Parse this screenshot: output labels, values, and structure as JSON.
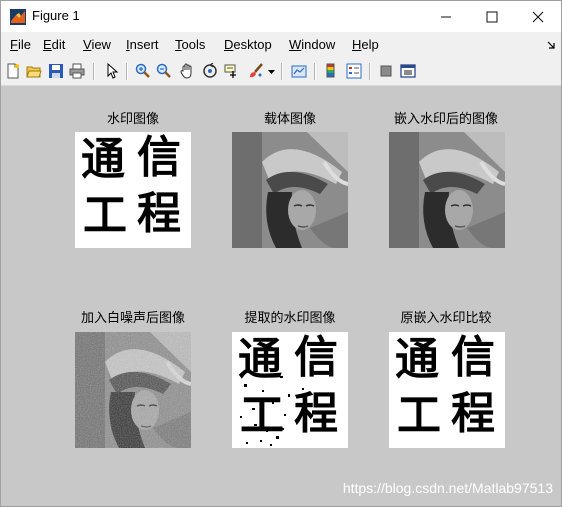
{
  "window": {
    "title": "Figure 1"
  },
  "menu": [
    {
      "u": "F",
      "rest": "ile"
    },
    {
      "u": "E",
      "rest": "dit"
    },
    {
      "u": "V",
      "rest": "iew"
    },
    {
      "u": "I",
      "rest": "nsert"
    },
    {
      "u": "T",
      "rest": "ools"
    },
    {
      "u": "D",
      "rest": "esktop"
    },
    {
      "u": "W",
      "rest": "indow"
    },
    {
      "u": "H",
      "rest": "elp"
    }
  ],
  "toolbar_icons": [
    "new-figure-icon",
    "open-file-icon",
    "save-icon",
    "print-icon",
    "pointer-icon",
    "zoom-in-icon",
    "zoom-out-icon",
    "pan-icon",
    "rotate-3d-icon",
    "data-cursor-icon",
    "brush-icon",
    "link-plot-icon",
    "colorbar-icon",
    "legend-icon",
    "hide-plot-tools-icon",
    "show-plot-tools-icon"
  ],
  "subplots": [
    {
      "title": "水印图像",
      "kind": "watermark"
    },
    {
      "title": "载体图像",
      "kind": "photo"
    },
    {
      "title": "嵌入水印后的图像",
      "kind": "photo"
    },
    {
      "title": "加入白噪声后图像",
      "kind": "photo-noisy"
    },
    {
      "title": "提取的水印图像",
      "kind": "watermark-noisy"
    },
    {
      "title": "原嵌入水印比较",
      "kind": "watermark"
    }
  ],
  "watermark_text": {
    "line1a": "通",
    "line1b": "信",
    "line2a": "工",
    "line2b": "程"
  },
  "footer": {
    "credit": "https://blog.csdn.net/Matlab97513"
  }
}
